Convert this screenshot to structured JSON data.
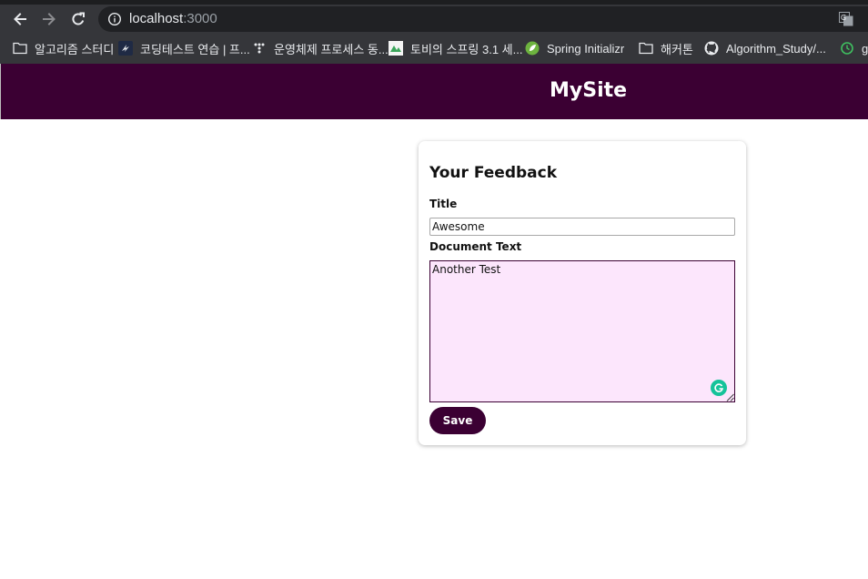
{
  "browser": {
    "url_host": "localhost",
    "url_port": ":3000",
    "bookmarks": [
      {
        "label": "알고리즘 스터디",
        "icon": "folder-icon"
      },
      {
        "label": "코딩테스트 연습 | 프...",
        "icon": "site-favicon-icon"
      },
      {
        "label": "운영체제 프로세스 동...",
        "icon": "dots-favicon-icon"
      },
      {
        "label": "토비의 스프링 3.1 세...",
        "icon": "image-favicon-icon"
      },
      {
        "label": "Spring Initializr",
        "icon": "spring-icon"
      },
      {
        "label": "해커톤",
        "icon": "folder-icon"
      },
      {
        "label": "Algorithm_Study/...",
        "icon": "github-icon"
      },
      {
        "label": "g",
        "icon": "clock-favicon-icon"
      }
    ]
  },
  "header": {
    "title": "MySite",
    "background": "#3b0033"
  },
  "form": {
    "heading": "Your Feedback",
    "title_label": "Title",
    "title_value": "Awesome",
    "text_label": "Document Text",
    "text_value": "Another Test",
    "save_label": "Save",
    "textarea_background": "#fce6fc",
    "accent": "#3b0033"
  }
}
